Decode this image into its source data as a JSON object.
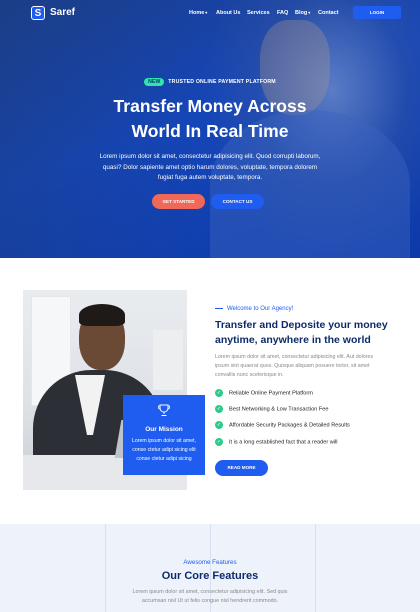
{
  "nav": {
    "logo_letter": "S",
    "brand": "Saref",
    "items": [
      "Home",
      "About Us",
      "Services",
      "FAQ",
      "Blog",
      "Contact"
    ],
    "login": "LOGIN"
  },
  "hero": {
    "badge": "NEW",
    "tagline": "TRUSTED ONLINE PAYMENT PLATFORM",
    "title_line1": "Transfer Money Across",
    "title_line2": "World In Real Time",
    "desc_line1": "Lorem ipsum dolor sit amet, consectetur adipisicing elit. Quod corrupti laborum,",
    "desc_line2": "quasi? Dolor sapiente amet optio harum dolores, voluptate, tempora dolorem",
    "desc_line3": "fugiat fuga autem voluptate, tempora.",
    "btn_start": "GET STARTED",
    "btn_contact": "CONTACT US"
  },
  "about": {
    "mission_title": "Our Mission",
    "mission_line1": "Lorem ipsum dolor sit amet,",
    "mission_line2": "conse ctetur adipi sicing elit",
    "mission_line3": "conse ctetur adipi sicing",
    "tag": "Welcome to Our Agency!",
    "title_line1": "Transfer and Deposite your money",
    "title_line2": "anytime, anywhere in the world",
    "desc_line1": "Lorem ipsum dolor sit amet, consectetur adipisicing elit. Aut dolores",
    "desc_line2": "ipsum sint quaerat quos. Quisque aliquam posuere tortor, sit amet",
    "desc_line3": "convallis nunc scelerisque in.",
    "checks": [
      "Reliable Online Payment Platform",
      "Best Networking & Low Transaction Fee",
      "Affordable Security Packages & Detailed Results",
      "It is a long established fact that a reader will"
    ],
    "btn_more": "READ MORE"
  },
  "features": {
    "subtitle": "Awesome Features",
    "title": "Our Core Features",
    "desc_line1": "Lorem ipsum dolor sit amet, consectetur adipisicing elit. Sed quis",
    "desc_line2": "accumsan nisl Ut ut felis congue nisl hendrerit commodo."
  },
  "colors": {
    "primary": "#1f5cf0",
    "accent": "#f0685a",
    "check": "#2ecc8a",
    "heading": "#0d2b6b"
  }
}
